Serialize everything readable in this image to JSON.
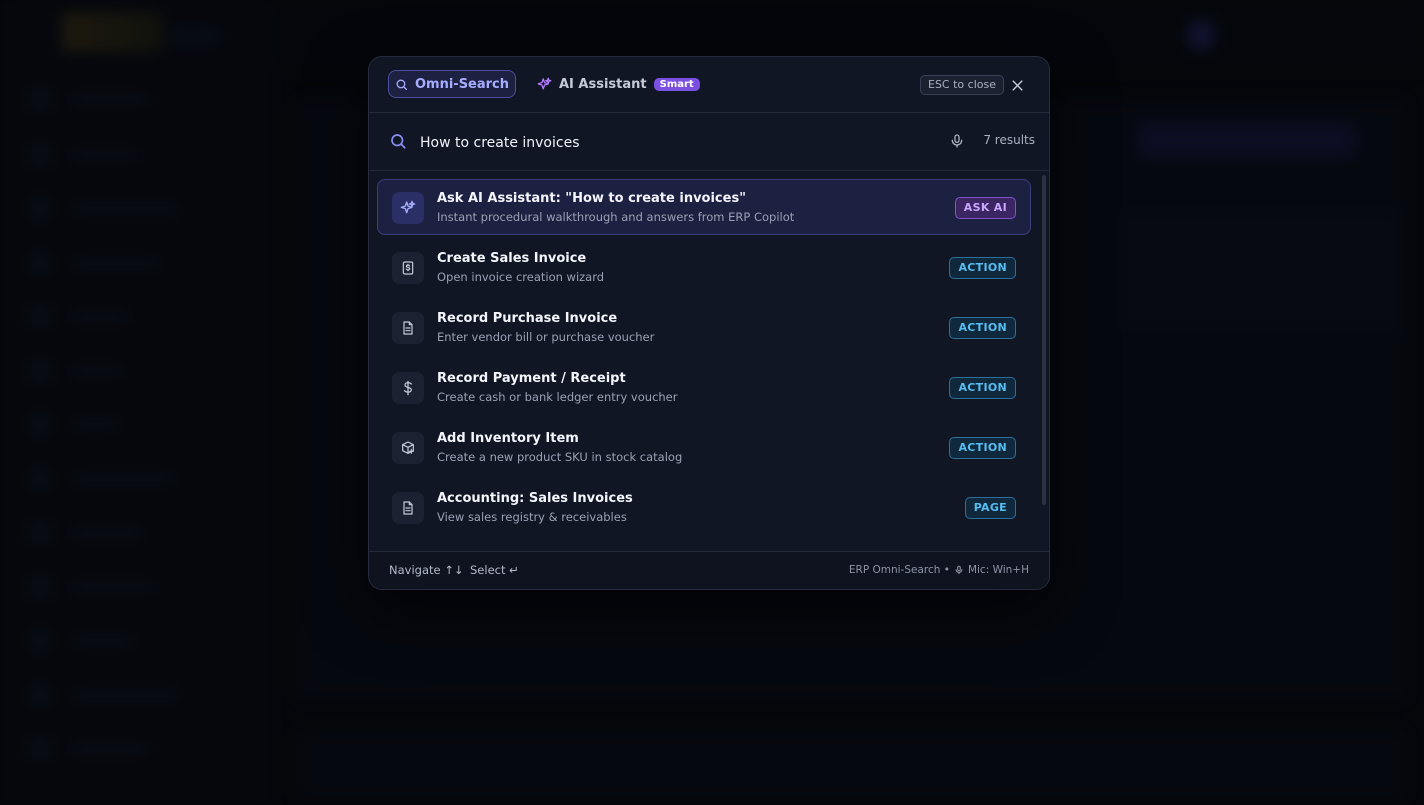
{
  "modal": {
    "tabs": {
      "omni_label": "Omni-Search",
      "ai_label": "AI Assistant",
      "ai_badge": "Smart"
    },
    "esc_hint": "ESC to close",
    "search": {
      "value": "How to create invoices",
      "result_count": "7 results"
    },
    "results": [
      {
        "title": "Ask AI Assistant: \"How to create invoices\"",
        "subtitle": "Instant procedural walkthrough and answers from ERP Copilot",
        "badge": "ASK AI",
        "icon": "sparkle-icon"
      },
      {
        "title": "Create Sales Invoice",
        "subtitle": "Open invoice creation wizard",
        "badge": "ACTION",
        "icon": "invoice-icon"
      },
      {
        "title": "Record Purchase Invoice",
        "subtitle": "Enter vendor bill or purchase voucher",
        "badge": "ACTION",
        "icon": "document-icon"
      },
      {
        "title": "Record Payment / Receipt",
        "subtitle": "Create cash or bank ledger entry voucher",
        "badge": "ACTION",
        "icon": "dollar-icon"
      },
      {
        "title": "Add Inventory Item",
        "subtitle": "Create a new product SKU in stock catalog",
        "badge": "ACTION",
        "icon": "package-plus-icon"
      },
      {
        "title": "Accounting: Sales Invoices",
        "subtitle": "View sales registry & receivables",
        "badge": "PAGE",
        "icon": "document-icon"
      }
    ],
    "footer": {
      "navigate": "Navigate ↑↓",
      "select": "Select ↵",
      "brand": "ERP Omni-Search •",
      "mic_hint": "Mic: Win+H"
    }
  },
  "colors": {
    "accent": "#a7adff",
    "ai_badge": "#7b4fe0",
    "action_badge": "#56bdf2",
    "modal_bg": "#111624"
  }
}
